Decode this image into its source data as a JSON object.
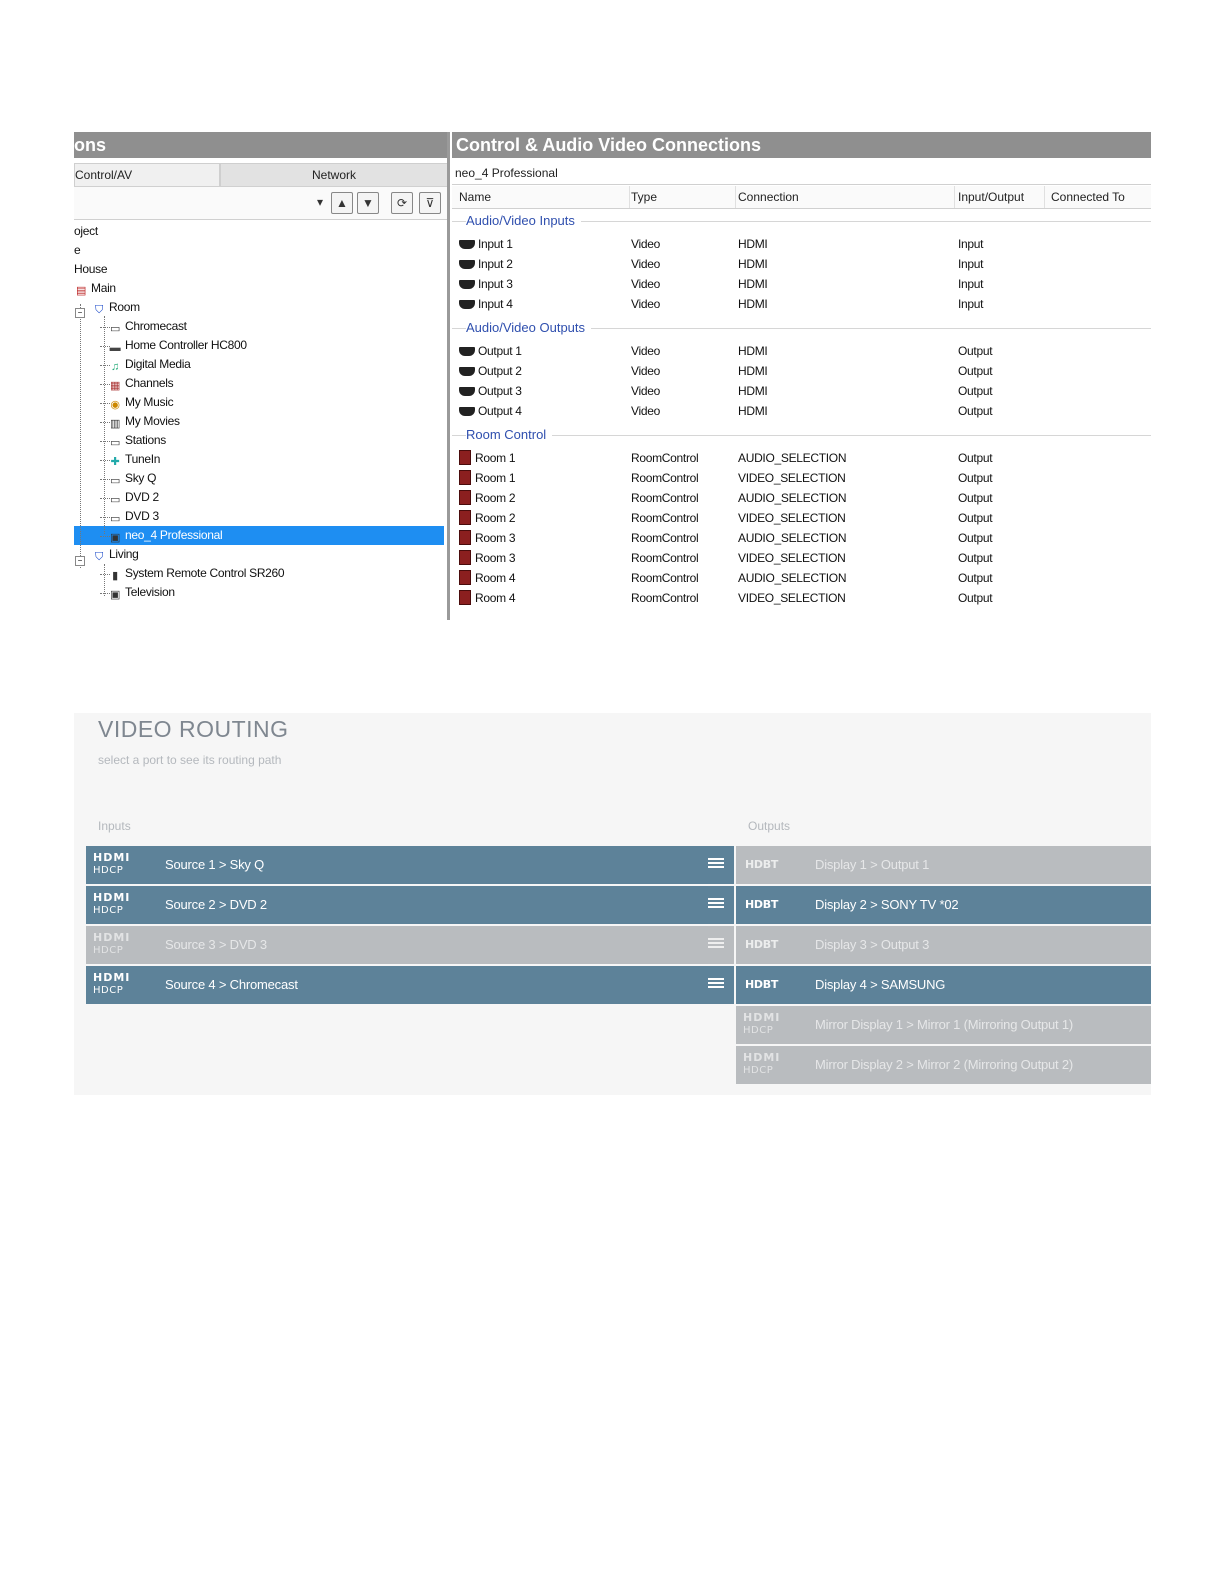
{
  "tree_panel": {
    "title": "ons",
    "tabs": [
      "Control/AV",
      "Network"
    ],
    "toolbar": {
      "dropdown": "▾",
      "up": "▲",
      "down": "▼",
      "refresh": "⟳",
      "filter": "⊽"
    },
    "nodes": [
      {
        "label": "oject",
        "depth": 0,
        "icon": ""
      },
      {
        "label": "e",
        "depth": 0,
        "icon": ""
      },
      {
        "label": "House",
        "depth": 0,
        "icon": ""
      },
      {
        "label": "Main",
        "depth": 0,
        "icon": "flag-icon"
      },
      {
        "label": "Room",
        "depth": 1,
        "icon": "shield-icon"
      },
      {
        "label": "Chromecast",
        "depth": 2,
        "icon": "device-icon"
      },
      {
        "label": "Home Controller HC800",
        "depth": 2,
        "icon": "controller-icon"
      },
      {
        "label": "Digital Media",
        "depth": 2,
        "icon": "media-icon"
      },
      {
        "label": "Channels",
        "depth": 2,
        "icon": "channels-icon"
      },
      {
        "label": "My Music",
        "depth": 2,
        "icon": "music-icon"
      },
      {
        "label": "My Movies",
        "depth": 2,
        "icon": "movies-icon"
      },
      {
        "label": "Stations",
        "depth": 2,
        "icon": "stations-icon"
      },
      {
        "label": "TuneIn",
        "depth": 2,
        "icon": "tunein-icon"
      },
      {
        "label": "Sky Q",
        "depth": 2,
        "icon": "device-icon"
      },
      {
        "label": "DVD 2",
        "depth": 2,
        "icon": "device-icon"
      },
      {
        "label": "DVD 3",
        "depth": 2,
        "icon": "device-icon"
      },
      {
        "label": "neo_4 Professional",
        "depth": 2,
        "icon": "matrix-icon",
        "selected": true
      },
      {
        "label": "Living",
        "depth": 1,
        "icon": "shield-icon"
      },
      {
        "label": "System Remote Control SR260",
        "depth": 2,
        "icon": "remote-icon"
      },
      {
        "label": "Television",
        "depth": 2,
        "icon": "tv-icon"
      }
    ]
  },
  "connections": {
    "title": "Control & Audio Video Connections",
    "device": "neo_4 Professional",
    "columns": [
      "Name",
      "Type",
      "Connection",
      "Input/Output",
      "Connected To"
    ],
    "groups": [
      {
        "label": "Audio/Video Inputs",
        "rows": [
          {
            "name": "Input 1",
            "type": "Video",
            "connection": "HDMI",
            "io": "Input"
          },
          {
            "name": "Input 2",
            "type": "Video",
            "connection": "HDMI",
            "io": "Input"
          },
          {
            "name": "Input 3",
            "type": "Video",
            "connection": "HDMI",
            "io": "Input"
          },
          {
            "name": "Input 4",
            "type": "Video",
            "connection": "HDMI",
            "io": "Input"
          }
        ]
      },
      {
        "label": "Audio/Video Outputs",
        "rows": [
          {
            "name": "Output 1",
            "type": "Video",
            "connection": "HDMI",
            "io": "Output"
          },
          {
            "name": "Output 2",
            "type": "Video",
            "connection": "HDMI",
            "io": "Output"
          },
          {
            "name": "Output 3",
            "type": "Video",
            "connection": "HDMI",
            "io": "Output"
          },
          {
            "name": "Output 4",
            "type": "Video",
            "connection": "HDMI",
            "io": "Output"
          }
        ]
      },
      {
        "label": "Room Control",
        "rows": [
          {
            "name": "Room 1",
            "type": "RoomControl",
            "connection": "AUDIO_SELECTION",
            "io": "Output"
          },
          {
            "name": "Room 1",
            "type": "RoomControl",
            "connection": "VIDEO_SELECTION",
            "io": "Output"
          },
          {
            "name": "Room 2",
            "type": "RoomControl",
            "connection": "AUDIO_SELECTION",
            "io": "Output"
          },
          {
            "name": "Room 2",
            "type": "RoomControl",
            "connection": "VIDEO_SELECTION",
            "io": "Output"
          },
          {
            "name": "Room 3",
            "type": "RoomControl",
            "connection": "AUDIO_SELECTION",
            "io": "Output"
          },
          {
            "name": "Room 3",
            "type": "RoomControl",
            "connection": "VIDEO_SELECTION",
            "io": "Output"
          },
          {
            "name": "Room 4",
            "type": "RoomControl",
            "connection": "AUDIO_SELECTION",
            "io": "Output"
          },
          {
            "name": "Room 4",
            "type": "RoomControl",
            "connection": "VIDEO_SELECTION",
            "io": "Output"
          }
        ]
      }
    ]
  },
  "routing": {
    "title": "VIDEO ROUTING",
    "subtitle": "select a port to see its routing path",
    "inputs_label": "Inputs",
    "outputs_label": "Outputs",
    "badge_hdmi_top": "HDMI",
    "badge_hdmi_bottom": "HDCP",
    "badge_hdbt": "HDBT",
    "inputs": [
      {
        "label": "Source 1 > Sky Q",
        "active": true
      },
      {
        "label": "Source 2 > DVD 2",
        "active": true
      },
      {
        "label": "Source 3 > DVD 3",
        "active": false
      },
      {
        "label": "Source 4 > Chromecast",
        "active": true
      }
    ],
    "outputs": [
      {
        "label": "Display 1 > Output 1",
        "active": false,
        "badge": "hdbt"
      },
      {
        "label": "Display 2 > SONY TV *02",
        "active": true,
        "badge": "hdbt"
      },
      {
        "label": "Display 3 > Output 3",
        "active": false,
        "badge": "hdbt"
      },
      {
        "label": "Display 4 > SAMSUNG",
        "active": true,
        "badge": "hdbt"
      },
      {
        "label": "Mirror Display 1 > Mirror 1 (Mirroring Output 1)",
        "active": false,
        "badge": "hdmi"
      },
      {
        "label": "Mirror Display 2 > Mirror 2 (Mirroring Output 2)",
        "active": false,
        "badge": "hdmi"
      }
    ]
  },
  "colors": {
    "active_row": "#5d8299",
    "inactive_row": "#b9bcbf",
    "selection": "#1e8ef2",
    "group_label": "#2f4fae"
  }
}
